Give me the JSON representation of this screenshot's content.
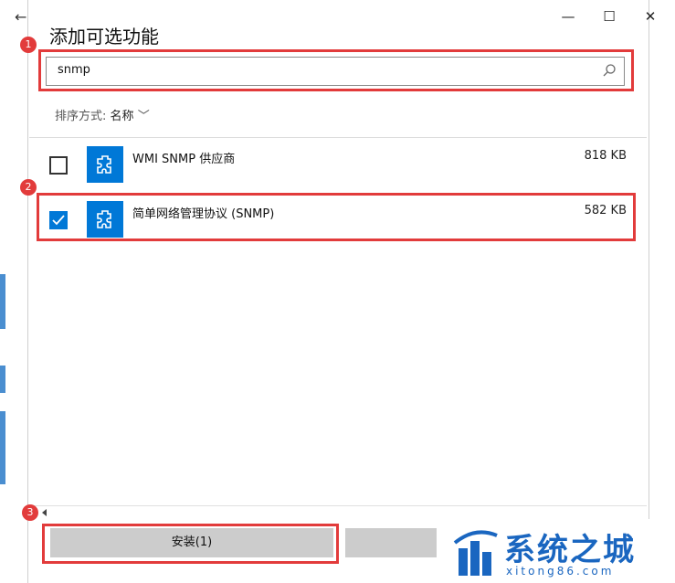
{
  "window": {
    "title": "添加可选功能",
    "minimize": "—",
    "maximize": "☐",
    "close": "✕",
    "back": "←"
  },
  "search": {
    "value": "snmp",
    "icon": "search-icon"
  },
  "sort": {
    "label": "排序方式:",
    "value": "名称",
    "chevron": "﹀"
  },
  "items": [
    {
      "name": "WMI SNMP 供应商",
      "size": "818 KB",
      "checked": false
    },
    {
      "name": "简单网络管理协议 (SNMP)",
      "size": "582 KB",
      "checked": true
    }
  ],
  "footer": {
    "install_label": "安装(1)"
  },
  "annotations": [
    "1",
    "2",
    "3"
  ],
  "watermark": {
    "title": "系统之城",
    "subtitle": "xitong86.com"
  },
  "colors": {
    "accent": "#0078d7",
    "highlight": "#e23b3b"
  }
}
